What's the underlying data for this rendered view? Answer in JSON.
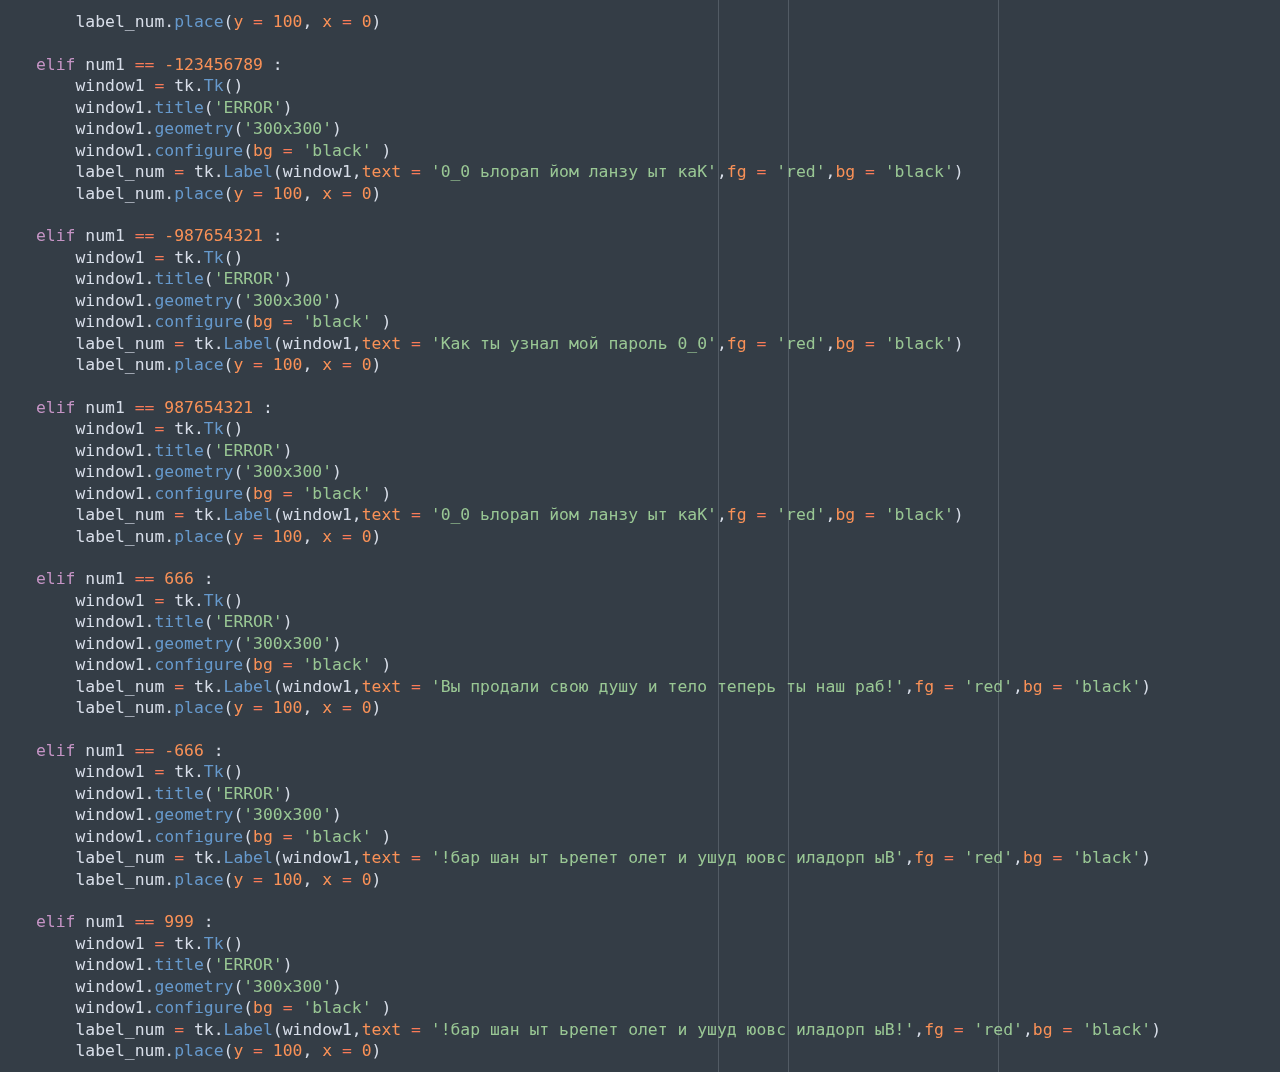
{
  "editor": {
    "lines": [
      {
        "kind": "code",
        "tokens": [
          {
            "kind": "plain",
            "text": "    label_num."
          },
          {
            "kind": "fn",
            "text": "place"
          },
          {
            "kind": "plain",
            "text": "("
          },
          {
            "kind": "param",
            "text": "y"
          },
          {
            "kind": "op",
            "text": " = "
          },
          {
            "kind": "num",
            "text": "100"
          },
          {
            "kind": "plain",
            "text": ", "
          },
          {
            "kind": "param",
            "text": "x"
          },
          {
            "kind": "op",
            "text": " = "
          },
          {
            "kind": "num",
            "text": "0"
          },
          {
            "kind": "plain",
            "text": ")"
          }
        ]
      },
      {
        "kind": "blank"
      },
      {
        "kind": "code",
        "tokens": [
          {
            "kind": "kw",
            "text": "elif"
          },
          {
            "kind": "plain",
            "text": " num1"
          },
          {
            "kind": "op",
            "text": " == "
          },
          {
            "kind": "num",
            "text": "-123456789"
          },
          {
            "kind": "plain",
            "text": " :"
          }
        ]
      },
      {
        "kind": "code",
        "tokens": [
          {
            "kind": "plain",
            "text": "    window1"
          },
          {
            "kind": "op",
            "text": " = "
          },
          {
            "kind": "plain",
            "text": "tk."
          },
          {
            "kind": "fn",
            "text": "Tk"
          },
          {
            "kind": "plain",
            "text": "()"
          }
        ]
      },
      {
        "kind": "code",
        "tokens": [
          {
            "kind": "plain",
            "text": "    window1."
          },
          {
            "kind": "fn",
            "text": "title"
          },
          {
            "kind": "plain",
            "text": "("
          },
          {
            "kind": "str",
            "text": "'ERROR'"
          },
          {
            "kind": "plain",
            "text": ")"
          }
        ]
      },
      {
        "kind": "code",
        "tokens": [
          {
            "kind": "plain",
            "text": "    window1."
          },
          {
            "kind": "fn",
            "text": "geometry"
          },
          {
            "kind": "plain",
            "text": "("
          },
          {
            "kind": "str",
            "text": "'300x300'"
          },
          {
            "kind": "plain",
            "text": ")"
          }
        ]
      },
      {
        "kind": "code",
        "tokens": [
          {
            "kind": "plain",
            "text": "    window1."
          },
          {
            "kind": "fn",
            "text": "configure"
          },
          {
            "kind": "plain",
            "text": "("
          },
          {
            "kind": "param",
            "text": "bg"
          },
          {
            "kind": "op",
            "text": " = "
          },
          {
            "kind": "str",
            "text": "'black'"
          },
          {
            "kind": "plain",
            "text": " )"
          }
        ]
      },
      {
        "kind": "code",
        "tokens": [
          {
            "kind": "plain",
            "text": "    label_num"
          },
          {
            "kind": "op",
            "text": " = "
          },
          {
            "kind": "plain",
            "text": "tk."
          },
          {
            "kind": "fn",
            "text": "Label"
          },
          {
            "kind": "plain",
            "text": "(window1,"
          },
          {
            "kind": "param",
            "text": "text"
          },
          {
            "kind": "op",
            "text": " = "
          },
          {
            "kind": "str",
            "text": "'0_0 ьлорап йом ланзу ыт каК'"
          },
          {
            "kind": "plain",
            "text": ","
          },
          {
            "kind": "param",
            "text": "fg"
          },
          {
            "kind": "op",
            "text": " = "
          },
          {
            "kind": "str",
            "text": "'red'"
          },
          {
            "kind": "plain",
            "text": ","
          },
          {
            "kind": "param",
            "text": "bg"
          },
          {
            "kind": "op",
            "text": " = "
          },
          {
            "kind": "str",
            "text": "'black'"
          },
          {
            "kind": "plain",
            "text": ")"
          }
        ]
      },
      {
        "kind": "code",
        "tokens": [
          {
            "kind": "plain",
            "text": "    label_num."
          },
          {
            "kind": "fn",
            "text": "place"
          },
          {
            "kind": "plain",
            "text": "("
          },
          {
            "kind": "param",
            "text": "y"
          },
          {
            "kind": "op",
            "text": " = "
          },
          {
            "kind": "num",
            "text": "100"
          },
          {
            "kind": "plain",
            "text": ", "
          },
          {
            "kind": "param",
            "text": "x"
          },
          {
            "kind": "op",
            "text": " = "
          },
          {
            "kind": "num",
            "text": "0"
          },
          {
            "kind": "plain",
            "text": ")"
          }
        ]
      },
      {
        "kind": "blank"
      },
      {
        "kind": "code",
        "tokens": [
          {
            "kind": "kw",
            "text": "elif"
          },
          {
            "kind": "plain",
            "text": " num1"
          },
          {
            "kind": "op",
            "text": " == "
          },
          {
            "kind": "num",
            "text": "-987654321"
          },
          {
            "kind": "plain",
            "text": " :"
          }
        ]
      },
      {
        "kind": "code",
        "tokens": [
          {
            "kind": "plain",
            "text": "    window1"
          },
          {
            "kind": "op",
            "text": " = "
          },
          {
            "kind": "plain",
            "text": "tk."
          },
          {
            "kind": "fn",
            "text": "Tk"
          },
          {
            "kind": "plain",
            "text": "()"
          }
        ]
      },
      {
        "kind": "code",
        "tokens": [
          {
            "kind": "plain",
            "text": "    window1."
          },
          {
            "kind": "fn",
            "text": "title"
          },
          {
            "kind": "plain",
            "text": "("
          },
          {
            "kind": "str",
            "text": "'ERROR'"
          },
          {
            "kind": "plain",
            "text": ")"
          }
        ]
      },
      {
        "kind": "code",
        "tokens": [
          {
            "kind": "plain",
            "text": "    window1."
          },
          {
            "kind": "fn",
            "text": "geometry"
          },
          {
            "kind": "plain",
            "text": "("
          },
          {
            "kind": "str",
            "text": "'300x300'"
          },
          {
            "kind": "plain",
            "text": ")"
          }
        ]
      },
      {
        "kind": "code",
        "tokens": [
          {
            "kind": "plain",
            "text": "    window1."
          },
          {
            "kind": "fn",
            "text": "configure"
          },
          {
            "kind": "plain",
            "text": "("
          },
          {
            "kind": "param",
            "text": "bg"
          },
          {
            "kind": "op",
            "text": " = "
          },
          {
            "kind": "str",
            "text": "'black'"
          },
          {
            "kind": "plain",
            "text": " )"
          }
        ]
      },
      {
        "kind": "code",
        "tokens": [
          {
            "kind": "plain",
            "text": "    label_num"
          },
          {
            "kind": "op",
            "text": " = "
          },
          {
            "kind": "plain",
            "text": "tk."
          },
          {
            "kind": "fn",
            "text": "Label"
          },
          {
            "kind": "plain",
            "text": "(window1,"
          },
          {
            "kind": "param",
            "text": "text"
          },
          {
            "kind": "op",
            "text": " = "
          },
          {
            "kind": "str",
            "text": "'Как ты узнал мой пароль 0_0'"
          },
          {
            "kind": "plain",
            "text": ","
          },
          {
            "kind": "param",
            "text": "fg"
          },
          {
            "kind": "op",
            "text": " = "
          },
          {
            "kind": "str",
            "text": "'red'"
          },
          {
            "kind": "plain",
            "text": ","
          },
          {
            "kind": "param",
            "text": "bg"
          },
          {
            "kind": "op",
            "text": " = "
          },
          {
            "kind": "str",
            "text": "'black'"
          },
          {
            "kind": "plain",
            "text": ")"
          }
        ]
      },
      {
        "kind": "code",
        "tokens": [
          {
            "kind": "plain",
            "text": "    label_num."
          },
          {
            "kind": "fn",
            "text": "place"
          },
          {
            "kind": "plain",
            "text": "("
          },
          {
            "kind": "param",
            "text": "y"
          },
          {
            "kind": "op",
            "text": " = "
          },
          {
            "kind": "num",
            "text": "100"
          },
          {
            "kind": "plain",
            "text": ", "
          },
          {
            "kind": "param",
            "text": "x"
          },
          {
            "kind": "op",
            "text": " = "
          },
          {
            "kind": "num",
            "text": "0"
          },
          {
            "kind": "plain",
            "text": ")"
          }
        ]
      },
      {
        "kind": "blank"
      },
      {
        "kind": "code",
        "tokens": [
          {
            "kind": "kw",
            "text": "elif"
          },
          {
            "kind": "plain",
            "text": " num1"
          },
          {
            "kind": "op",
            "text": " == "
          },
          {
            "kind": "num",
            "text": "987654321"
          },
          {
            "kind": "plain",
            "text": " :"
          }
        ]
      },
      {
        "kind": "code",
        "tokens": [
          {
            "kind": "plain",
            "text": "    window1"
          },
          {
            "kind": "op",
            "text": " = "
          },
          {
            "kind": "plain",
            "text": "tk."
          },
          {
            "kind": "fn",
            "text": "Tk"
          },
          {
            "kind": "plain",
            "text": "()"
          }
        ]
      },
      {
        "kind": "code",
        "tokens": [
          {
            "kind": "plain",
            "text": "    window1."
          },
          {
            "kind": "fn",
            "text": "title"
          },
          {
            "kind": "plain",
            "text": "("
          },
          {
            "kind": "str",
            "text": "'ERROR'"
          },
          {
            "kind": "plain",
            "text": ")"
          }
        ]
      },
      {
        "kind": "code",
        "tokens": [
          {
            "kind": "plain",
            "text": "    window1."
          },
          {
            "kind": "fn",
            "text": "geometry"
          },
          {
            "kind": "plain",
            "text": "("
          },
          {
            "kind": "str",
            "text": "'300x300'"
          },
          {
            "kind": "plain",
            "text": ")"
          }
        ]
      },
      {
        "kind": "code",
        "tokens": [
          {
            "kind": "plain",
            "text": "    window1."
          },
          {
            "kind": "fn",
            "text": "configure"
          },
          {
            "kind": "plain",
            "text": "("
          },
          {
            "kind": "param",
            "text": "bg"
          },
          {
            "kind": "op",
            "text": " = "
          },
          {
            "kind": "str",
            "text": "'black'"
          },
          {
            "kind": "plain",
            "text": " )"
          }
        ]
      },
      {
        "kind": "code",
        "tokens": [
          {
            "kind": "plain",
            "text": "    label_num"
          },
          {
            "kind": "op",
            "text": " = "
          },
          {
            "kind": "plain",
            "text": "tk."
          },
          {
            "kind": "fn",
            "text": "Label"
          },
          {
            "kind": "plain",
            "text": "(window1,"
          },
          {
            "kind": "param",
            "text": "text"
          },
          {
            "kind": "op",
            "text": " = "
          },
          {
            "kind": "str",
            "text": "'0_0 ьлорап йом ланзу ыт каК'"
          },
          {
            "kind": "plain",
            "text": ","
          },
          {
            "kind": "param",
            "text": "fg"
          },
          {
            "kind": "op",
            "text": " = "
          },
          {
            "kind": "str",
            "text": "'red'"
          },
          {
            "kind": "plain",
            "text": ","
          },
          {
            "kind": "param",
            "text": "bg"
          },
          {
            "kind": "op",
            "text": " = "
          },
          {
            "kind": "str",
            "text": "'black'"
          },
          {
            "kind": "plain",
            "text": ")"
          }
        ]
      },
      {
        "kind": "code",
        "tokens": [
          {
            "kind": "plain",
            "text": "    label_num."
          },
          {
            "kind": "fn",
            "text": "place"
          },
          {
            "kind": "plain",
            "text": "("
          },
          {
            "kind": "param",
            "text": "y"
          },
          {
            "kind": "op",
            "text": " = "
          },
          {
            "kind": "num",
            "text": "100"
          },
          {
            "kind": "plain",
            "text": ", "
          },
          {
            "kind": "param",
            "text": "x"
          },
          {
            "kind": "op",
            "text": " = "
          },
          {
            "kind": "num",
            "text": "0"
          },
          {
            "kind": "plain",
            "text": ")"
          }
        ]
      },
      {
        "kind": "blank"
      },
      {
        "kind": "code",
        "tokens": [
          {
            "kind": "kw",
            "text": "elif"
          },
          {
            "kind": "plain",
            "text": " num1"
          },
          {
            "kind": "op",
            "text": " == "
          },
          {
            "kind": "num",
            "text": "666"
          },
          {
            "kind": "plain",
            "text": " :"
          }
        ]
      },
      {
        "kind": "code",
        "tokens": [
          {
            "kind": "plain",
            "text": "    window1"
          },
          {
            "kind": "op",
            "text": " = "
          },
          {
            "kind": "plain",
            "text": "tk."
          },
          {
            "kind": "fn",
            "text": "Tk"
          },
          {
            "kind": "plain",
            "text": "()"
          }
        ]
      },
      {
        "kind": "code",
        "tokens": [
          {
            "kind": "plain",
            "text": "    window1."
          },
          {
            "kind": "fn",
            "text": "title"
          },
          {
            "kind": "plain",
            "text": "("
          },
          {
            "kind": "str",
            "text": "'ERROR'"
          },
          {
            "kind": "plain",
            "text": ")"
          }
        ]
      },
      {
        "kind": "code",
        "tokens": [
          {
            "kind": "plain",
            "text": "    window1."
          },
          {
            "kind": "fn",
            "text": "geometry"
          },
          {
            "kind": "plain",
            "text": "("
          },
          {
            "kind": "str",
            "text": "'300x300'"
          },
          {
            "kind": "plain",
            "text": ")"
          }
        ]
      },
      {
        "kind": "code",
        "tokens": [
          {
            "kind": "plain",
            "text": "    window1."
          },
          {
            "kind": "fn",
            "text": "configure"
          },
          {
            "kind": "plain",
            "text": "("
          },
          {
            "kind": "param",
            "text": "bg"
          },
          {
            "kind": "op",
            "text": " = "
          },
          {
            "kind": "str",
            "text": "'black'"
          },
          {
            "kind": "plain",
            "text": " )"
          }
        ]
      },
      {
        "kind": "code",
        "tokens": [
          {
            "kind": "plain",
            "text": "    label_num"
          },
          {
            "kind": "op",
            "text": " = "
          },
          {
            "kind": "plain",
            "text": "tk."
          },
          {
            "kind": "fn",
            "text": "Label"
          },
          {
            "kind": "plain",
            "text": "(window1,"
          },
          {
            "kind": "param",
            "text": "text"
          },
          {
            "kind": "op",
            "text": " = "
          },
          {
            "kind": "str",
            "text": "'Вы продали свою душу и тело теперь ты наш раб!'"
          },
          {
            "kind": "plain",
            "text": ","
          },
          {
            "kind": "param",
            "text": "fg"
          },
          {
            "kind": "op",
            "text": " = "
          },
          {
            "kind": "str",
            "text": "'red'"
          },
          {
            "kind": "plain",
            "text": ","
          },
          {
            "kind": "param",
            "text": "bg"
          },
          {
            "kind": "op",
            "text": " = "
          },
          {
            "kind": "str",
            "text": "'black'"
          },
          {
            "kind": "plain",
            "text": ")"
          }
        ]
      },
      {
        "kind": "code",
        "tokens": [
          {
            "kind": "plain",
            "text": "    label_num."
          },
          {
            "kind": "fn",
            "text": "place"
          },
          {
            "kind": "plain",
            "text": "("
          },
          {
            "kind": "param",
            "text": "y"
          },
          {
            "kind": "op",
            "text": " = "
          },
          {
            "kind": "num",
            "text": "100"
          },
          {
            "kind": "plain",
            "text": ", "
          },
          {
            "kind": "param",
            "text": "x"
          },
          {
            "kind": "op",
            "text": " = "
          },
          {
            "kind": "num",
            "text": "0"
          },
          {
            "kind": "plain",
            "text": ")"
          }
        ]
      },
      {
        "kind": "blank"
      },
      {
        "kind": "code",
        "tokens": [
          {
            "kind": "kw",
            "text": "elif"
          },
          {
            "kind": "plain",
            "text": " num1"
          },
          {
            "kind": "op",
            "text": " == "
          },
          {
            "kind": "num",
            "text": "-666"
          },
          {
            "kind": "plain",
            "text": " :"
          }
        ]
      },
      {
        "kind": "code",
        "tokens": [
          {
            "kind": "plain",
            "text": "    window1"
          },
          {
            "kind": "op",
            "text": " = "
          },
          {
            "kind": "plain",
            "text": "tk."
          },
          {
            "kind": "fn",
            "text": "Tk"
          },
          {
            "kind": "plain",
            "text": "()"
          }
        ]
      },
      {
        "kind": "code",
        "tokens": [
          {
            "kind": "plain",
            "text": "    window1."
          },
          {
            "kind": "fn",
            "text": "title"
          },
          {
            "kind": "plain",
            "text": "("
          },
          {
            "kind": "str",
            "text": "'ERROR'"
          },
          {
            "kind": "plain",
            "text": ")"
          }
        ]
      },
      {
        "kind": "code",
        "tokens": [
          {
            "kind": "plain",
            "text": "    window1."
          },
          {
            "kind": "fn",
            "text": "geometry"
          },
          {
            "kind": "plain",
            "text": "("
          },
          {
            "kind": "str",
            "text": "'300x300'"
          },
          {
            "kind": "plain",
            "text": ")"
          }
        ]
      },
      {
        "kind": "code",
        "tokens": [
          {
            "kind": "plain",
            "text": "    window1."
          },
          {
            "kind": "fn",
            "text": "configure"
          },
          {
            "kind": "plain",
            "text": "("
          },
          {
            "kind": "param",
            "text": "bg"
          },
          {
            "kind": "op",
            "text": " = "
          },
          {
            "kind": "str",
            "text": "'black'"
          },
          {
            "kind": "plain",
            "text": " )"
          }
        ]
      },
      {
        "kind": "code",
        "tokens": [
          {
            "kind": "plain",
            "text": "    label_num"
          },
          {
            "kind": "op",
            "text": " = "
          },
          {
            "kind": "plain",
            "text": "tk."
          },
          {
            "kind": "fn",
            "text": "Label"
          },
          {
            "kind": "plain",
            "text": "(window1,"
          },
          {
            "kind": "param",
            "text": "text"
          },
          {
            "kind": "op",
            "text": " = "
          },
          {
            "kind": "str",
            "text": "'!бар шан ыт ьрепет олет и ушуд юовс иладорп ыВ'"
          },
          {
            "kind": "plain",
            "text": ","
          },
          {
            "kind": "param",
            "text": "fg"
          },
          {
            "kind": "op",
            "text": " = "
          },
          {
            "kind": "str",
            "text": "'red'"
          },
          {
            "kind": "plain",
            "text": ","
          },
          {
            "kind": "param",
            "text": "bg"
          },
          {
            "kind": "op",
            "text": " = "
          },
          {
            "kind": "str",
            "text": "'black'"
          },
          {
            "kind": "plain",
            "text": ")"
          }
        ]
      },
      {
        "kind": "code",
        "tokens": [
          {
            "kind": "plain",
            "text": "    label_num."
          },
          {
            "kind": "fn",
            "text": "place"
          },
          {
            "kind": "plain",
            "text": "("
          },
          {
            "kind": "param",
            "text": "y"
          },
          {
            "kind": "op",
            "text": " = "
          },
          {
            "kind": "num",
            "text": "100"
          },
          {
            "kind": "plain",
            "text": ", "
          },
          {
            "kind": "param",
            "text": "x"
          },
          {
            "kind": "op",
            "text": " = "
          },
          {
            "kind": "num",
            "text": "0"
          },
          {
            "kind": "plain",
            "text": ")"
          }
        ]
      },
      {
        "kind": "blank"
      },
      {
        "kind": "code",
        "tokens": [
          {
            "kind": "kw",
            "text": "elif"
          },
          {
            "kind": "plain",
            "text": " num1"
          },
          {
            "kind": "op",
            "text": " == "
          },
          {
            "kind": "num",
            "text": "999"
          },
          {
            "kind": "plain",
            "text": " :"
          }
        ]
      },
      {
        "kind": "code",
        "tokens": [
          {
            "kind": "plain",
            "text": "    window1"
          },
          {
            "kind": "op",
            "text": " = "
          },
          {
            "kind": "plain",
            "text": "tk."
          },
          {
            "kind": "fn",
            "text": "Tk"
          },
          {
            "kind": "plain",
            "text": "()"
          }
        ]
      },
      {
        "kind": "code",
        "tokens": [
          {
            "kind": "plain",
            "text": "    window1."
          },
          {
            "kind": "fn",
            "text": "title"
          },
          {
            "kind": "plain",
            "text": "("
          },
          {
            "kind": "str",
            "text": "'ERROR'"
          },
          {
            "kind": "plain",
            "text": ")"
          }
        ]
      },
      {
        "kind": "code",
        "tokens": [
          {
            "kind": "plain",
            "text": "    window1."
          },
          {
            "kind": "fn",
            "text": "geometry"
          },
          {
            "kind": "plain",
            "text": "("
          },
          {
            "kind": "str",
            "text": "'300x300'"
          },
          {
            "kind": "plain",
            "text": ")"
          }
        ]
      },
      {
        "kind": "code",
        "tokens": [
          {
            "kind": "plain",
            "text": "    window1."
          },
          {
            "kind": "fn",
            "text": "configure"
          },
          {
            "kind": "plain",
            "text": "("
          },
          {
            "kind": "param",
            "text": "bg"
          },
          {
            "kind": "op",
            "text": " = "
          },
          {
            "kind": "str",
            "text": "'black'"
          },
          {
            "kind": "plain",
            "text": " )"
          }
        ]
      },
      {
        "kind": "code",
        "tokens": [
          {
            "kind": "plain",
            "text": "    label_num"
          },
          {
            "kind": "op",
            "text": " = "
          },
          {
            "kind": "plain",
            "text": "tk."
          },
          {
            "kind": "fn",
            "text": "Label"
          },
          {
            "kind": "plain",
            "text": "(window1,"
          },
          {
            "kind": "param",
            "text": "text"
          },
          {
            "kind": "op",
            "text": " = "
          },
          {
            "kind": "str",
            "text": "'!бар шан ыт ьрепет олет и ушуд юовс иладорп ыВ!'"
          },
          {
            "kind": "plain",
            "text": ","
          },
          {
            "kind": "param",
            "text": "fg"
          },
          {
            "kind": "op",
            "text": " = "
          },
          {
            "kind": "str",
            "text": "'red'"
          },
          {
            "kind": "plain",
            "text": ","
          },
          {
            "kind": "param",
            "text": "bg"
          },
          {
            "kind": "op",
            "text": " = "
          },
          {
            "kind": "str",
            "text": "'black'"
          },
          {
            "kind": "plain",
            "text": ")"
          }
        ]
      },
      {
        "kind": "code",
        "tokens": [
          {
            "kind": "plain",
            "text": "    label_num."
          },
          {
            "kind": "fn",
            "text": "place"
          },
          {
            "kind": "plain",
            "text": "("
          },
          {
            "kind": "param",
            "text": "y"
          },
          {
            "kind": "op",
            "text": " = "
          },
          {
            "kind": "num",
            "text": "100"
          },
          {
            "kind": "plain",
            "text": ", "
          },
          {
            "kind": "param",
            "text": "x"
          },
          {
            "kind": "op",
            "text": " = "
          },
          {
            "kind": "num",
            "text": "0"
          },
          {
            "kind": "plain",
            "text": ")"
          }
        ]
      }
    ]
  }
}
